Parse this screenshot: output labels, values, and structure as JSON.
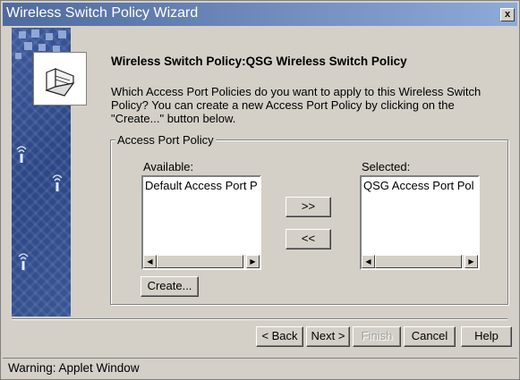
{
  "window": {
    "title": "Wireless Switch Policy Wizard",
    "close_label": "x"
  },
  "heading": "Wireless Switch Policy:QSG Wireless Switch Policy",
  "description": "Which Access Port Policies do you want to apply to this Wireless Switch Policy?  You can create a new Access Port Policy by clicking on the \"Create...\" button below.",
  "group": {
    "legend": "Access Port Policy",
    "available_label": "Available:",
    "selected_label": "Selected:",
    "available_items": [
      "Default Access Port P"
    ],
    "selected_items": [
      "QSG Access Port Pol"
    ],
    "add_label": ">>",
    "remove_label": "<<",
    "create_label": "Create..."
  },
  "footer": {
    "back_label": "< Back",
    "next_label": "Next >",
    "finish_label": "Finish",
    "cancel_label": "Cancel",
    "help_label": "Help"
  },
  "status": "Warning: Applet Window",
  "colors": {
    "titlebar_start": "#4f6a9e",
    "titlebar_end": "#8eaad8",
    "sidebar": "#2b4686",
    "face": "#d4d0c8"
  },
  "icons": {
    "logo": "access-port-device-icon",
    "scroll_left": "scroll-left-arrow",
    "scroll_right": "scroll-right-arrow"
  }
}
